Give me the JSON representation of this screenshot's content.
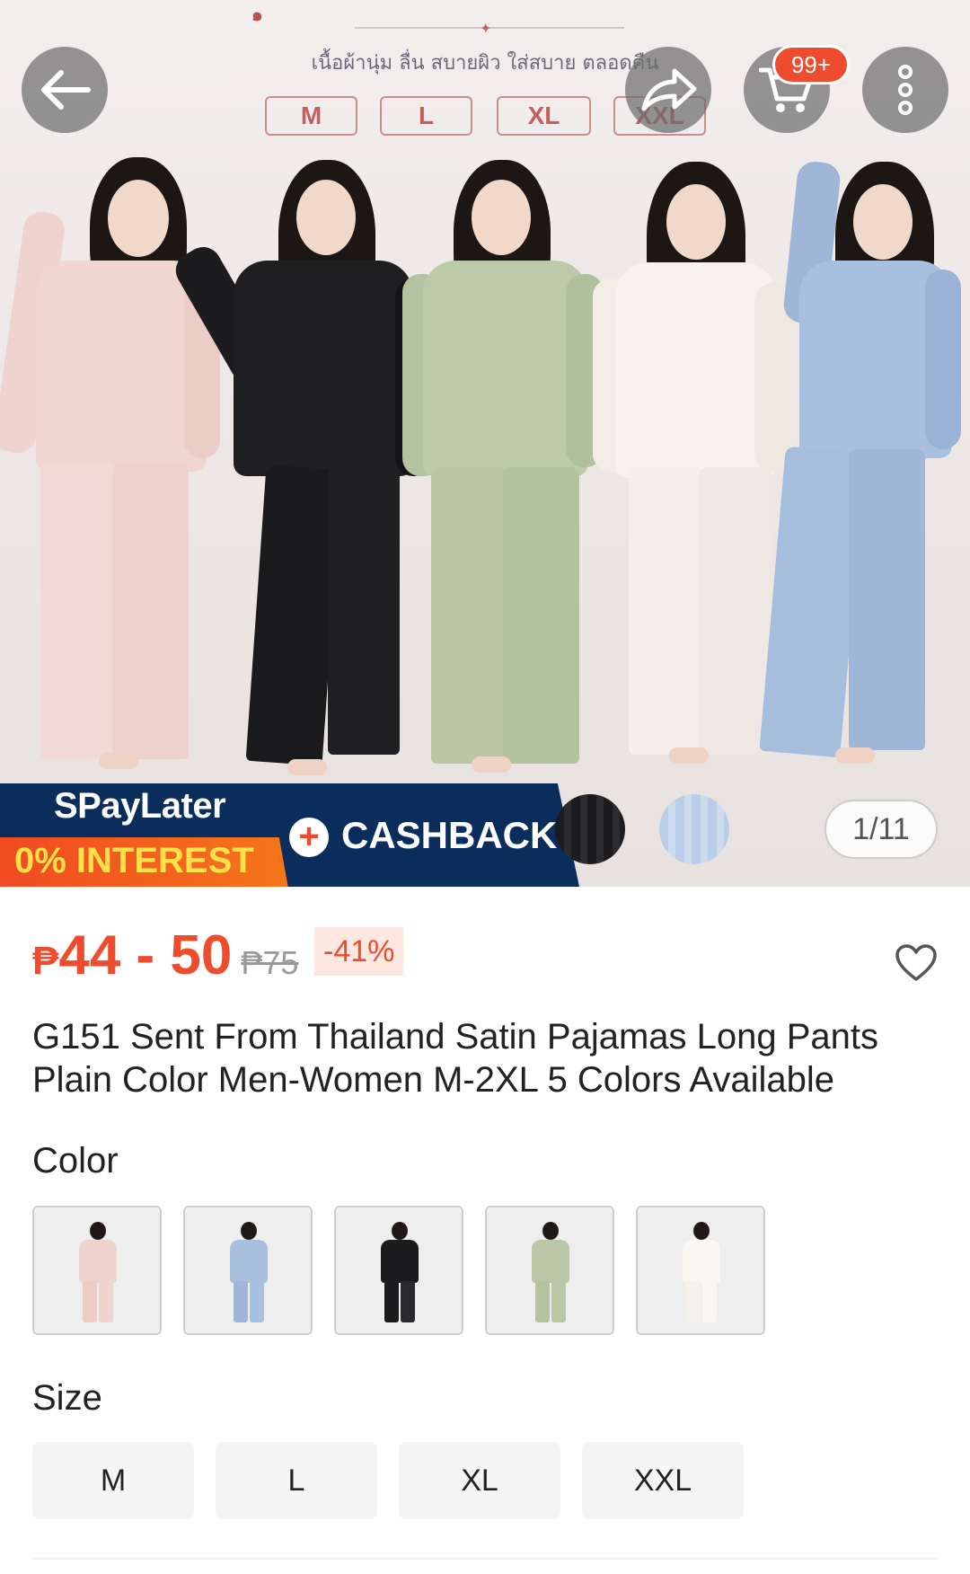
{
  "hero": {
    "caption": "เนื้อผ้านุ่ม ลื่น สบายผิว ใส่สบาย ตลอดคืน",
    "deco": "๑",
    "size_chips": [
      "M",
      "L",
      "XL",
      "XXL"
    ],
    "counter": "1/11"
  },
  "topbar": {
    "back_icon": "back-arrow-icon",
    "share_icon": "share-icon",
    "cart_icon": "cart-icon",
    "cart_badge": "99+",
    "more_icon": "more-vertical-icon"
  },
  "banner": {
    "spaylater": "SPayLater",
    "interest": "0% INTEREST",
    "plus": "+",
    "cashback": "CASHBACK"
  },
  "product": {
    "currency": "₱",
    "price_range": "44 - 50",
    "original_price": "₱75",
    "discount": "-41%",
    "title": "G151 Sent From Thailand Satin Pajamas Long Pants Plain Color Men-Women M-2XL 5 Colors Available"
  },
  "color_section": {
    "label": "Color",
    "options": [
      "pink",
      "blue",
      "black",
      "green",
      "white"
    ]
  },
  "size_section": {
    "label": "Size",
    "options": [
      "M",
      "L",
      "XL",
      "XXL"
    ]
  },
  "colors": {
    "accent": "#ee4d2d",
    "banner_navy": "#0a2d5c",
    "pink": "#efd3cf",
    "black": "#1c1c1e",
    "green": "#b9c7a6",
    "white": "#f6f1ec",
    "blue": "#a9bfdf"
  }
}
